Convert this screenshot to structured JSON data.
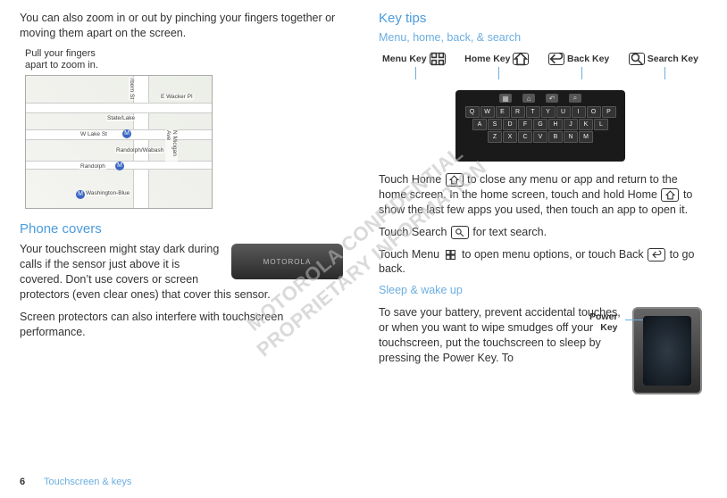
{
  "leftCol": {
    "intro": "You can also zoom in or out by pinching your fingers together or moving them apart on the screen.",
    "zoomHint1": "Pull your fingers",
    "zoomHint2": "apart to zoom in.",
    "map": {
      "street1": "E Wacker Pl",
      "street2": "W Lake St",
      "street3": "Randolph",
      "street4": "N Micigan Ave",
      "street5": "rborn St",
      "stop1": "State/Lake",
      "stop2": "Randolph/Wabash",
      "stop3": "Washington-Blue",
      "mark": "M"
    },
    "phoneCoversHeading": "Phone covers",
    "coverBrand": "MOTOROLA",
    "phoneCoversP1": "Your touchscreen might stay dark during calls if the sensor just above it is covered. Don’t use covers or screen protectors (even clear ones) that cover this sensor.",
    "phoneCoversP2": "Screen protectors can also interfere with touchscreen performance."
  },
  "rightCol": {
    "keyTipsHeading": "Key tips",
    "subHeading1": "Menu, home, back, & search",
    "labels": {
      "menu": "Menu Key",
      "home": "Home Key",
      "back": "Back Key",
      "search": "Search Key"
    },
    "keyboard": {
      "row1": [
        "Q",
        "W",
        "E",
        "R",
        "T",
        "Y",
        "U",
        "I",
        "O",
        "P"
      ],
      "row2": [
        "A",
        "S",
        "D",
        "F",
        "G",
        "H",
        "J",
        "K",
        "L"
      ],
      "row3": [
        "Z",
        "X",
        "C",
        "V",
        "B",
        "N",
        "M"
      ]
    },
    "para1a": "Touch Home ",
    "para1b": " to close any menu or app and return to the home screen. In the home screen, touch and hold Home ",
    "para1c": " to show the last few apps you used, then touch an app to open it.",
    "para2a": "Touch Search ",
    "para2b": " for text search.",
    "para3a": "Touch Menu ",
    "para3b": " to open menu options, or touch Back ",
    "para3c": " to go back.",
    "subHeading2": "Sleep & wake up",
    "sleepPara": "To save your battery, prevent accidental touches, or when you want to wipe smudges off your touchscreen, put the touchscreen to sleep by pressing the Power Key. To",
    "powerLabel1": "Power",
    "powerLabel2": "Key"
  },
  "footer": {
    "pageNum": "6",
    "chapter": "Touchscreen & keys"
  },
  "watermark": "MOTOROLA CONFIDENTIAL\nPROPRIETARY INFORMATION"
}
